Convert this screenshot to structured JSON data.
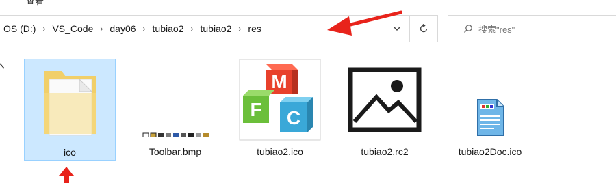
{
  "topmenu": {
    "label": "查看"
  },
  "addressbar": {
    "crumbs": [
      "OS (D:)",
      "VS_Code",
      "day06",
      "tubiao2",
      "tubiao2",
      "res"
    ]
  },
  "search": {
    "placeholder": "搜索\"res\""
  },
  "files": [
    {
      "name": "ico",
      "type": "folder",
      "selected": true
    },
    {
      "name": "Toolbar.bmp",
      "type": "bitmap"
    },
    {
      "name": "tubiao2.ico",
      "type": "mfc-icon"
    },
    {
      "name": "tubiao2.rc2",
      "type": "image-placeholder"
    },
    {
      "name": "tubiao2Doc.ico",
      "type": "doc-icon"
    }
  ],
  "colors": {
    "selection_bg": "#cce8ff",
    "selection_border": "#99d1ff",
    "annotation_red": "#e8231b"
  }
}
